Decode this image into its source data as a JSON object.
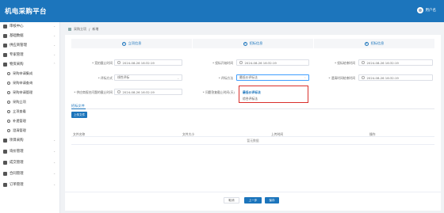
{
  "app": {
    "title": "机电采购平台",
    "user_name": "用户名"
  },
  "sidebar": {
    "items": [
      {
        "label": "审核中心",
        "icon": "user-icon"
      },
      {
        "label": "基础数据",
        "icon": "database-icon"
      },
      {
        "label": "供应商管理",
        "icon": "supplier-icon"
      },
      {
        "label": "专家管理",
        "icon": "expert-icon"
      },
      {
        "label": "物资采购",
        "icon": "purchase-icon"
      },
      {
        "label": "采购申请集成",
        "icon": "circle-icon"
      },
      {
        "label": "采购申请查询",
        "icon": "circle-icon"
      },
      {
        "label": "采购申请管理",
        "icon": "circle-icon"
      },
      {
        "label": "采购立项",
        "icon": "circle-icon"
      },
      {
        "label": "立项查看",
        "icon": "circle-icon"
      },
      {
        "label": "补遗管理",
        "icon": "circle-icon"
      },
      {
        "label": "澄清管理",
        "icon": "circle-icon"
      },
      {
        "label": "项目采购",
        "icon": "project-icon"
      },
      {
        "label": "询价管理",
        "icon": "inquiry-icon"
      },
      {
        "label": "成交管理",
        "icon": "deal-icon"
      },
      {
        "label": "合同管理",
        "icon": "contract-icon"
      },
      {
        "label": "订单管理",
        "icon": "order-icon"
      }
    ]
  },
  "breadcrumb": {
    "parent": "采购立项",
    "sep": "/",
    "current": "新增"
  },
  "steps": [
    {
      "num": "1",
      "label": "立项信息"
    },
    {
      "num": "2",
      "label": "招标信息"
    },
    {
      "num": "3",
      "label": "招标信息"
    }
  ],
  "form": {
    "publish_time_label": "* 竞拍截止时间",
    "publish_time_value": "2024-08-26 16:32:19",
    "bid_open_label": "* 投标开始时间",
    "bid_open_value": "2024-08-26 16:32:19",
    "bid_end_label": "* 投标结束时间",
    "bid_end_value": "2024-08-26 16:32:19",
    "eval_mode_label": "* 评标方式",
    "eval_mode_value": "线性评标",
    "eval_method_label": "* 评标方法",
    "eval_method_value": "最低价评标法",
    "clarify_label": "* 澄清时间结束时间",
    "clarify_value": "2024-08-26 16:32:19",
    "doc_deadline_label": "* 供应商报名问题的截止时间",
    "doc_deadline_value": "2024-08-26 16:32:19",
    "answer_label": "* 问题答复截止时间(天)",
    "answer_value": ""
  },
  "dropdown": {
    "options": [
      "最低价评标法",
      "综合评标法"
    ]
  },
  "files": {
    "tab_label": "招标文件",
    "upload_label": "上传文件",
    "columns": [
      "文件名称",
      "文件大小",
      "上传时间",
      "操作"
    ],
    "empty_text": "暂无数据"
  },
  "footer": {
    "cancel_label": "取消",
    "prev_label": "上一步",
    "save_label": "保存"
  },
  "colors": {
    "primary": "#1c75bc",
    "highlight": "#d9302c"
  }
}
